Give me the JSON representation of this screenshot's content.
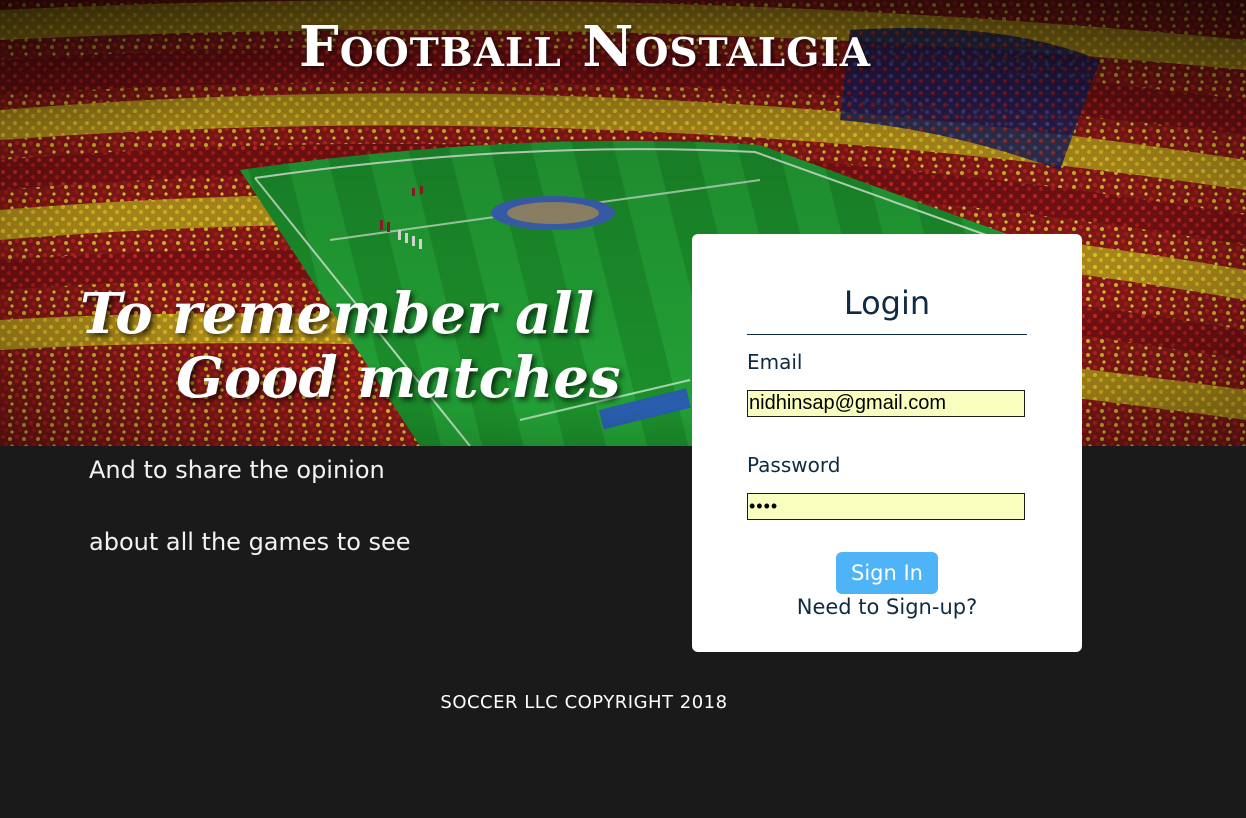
{
  "header": {
    "site_title": "Football Nostalgia"
  },
  "hero": {
    "tagline_line1": "To remember all",
    "tagline_line2": "Good matches"
  },
  "intro": {
    "line1": "And to share the opinion",
    "line2": "about all the games to see"
  },
  "login": {
    "title": "Login",
    "email_label": "Email",
    "email_value": "nidhinsap@gmail.com",
    "password_label": "Password",
    "password_value": "••••",
    "signin_label": "Sign In",
    "signup_link": "Need to Sign-up?"
  },
  "footer": {
    "copyright": "SOCCER LLC COPYRIGHT 2018"
  },
  "colors": {
    "page_background": "#1a1a1a",
    "card_background": "#ffffff",
    "text_dark": "#0f2b44",
    "button_blue": "#4fb3f7",
    "input_autofill": "#f8ffbe",
    "pitch_green": "#1f9a2e"
  }
}
